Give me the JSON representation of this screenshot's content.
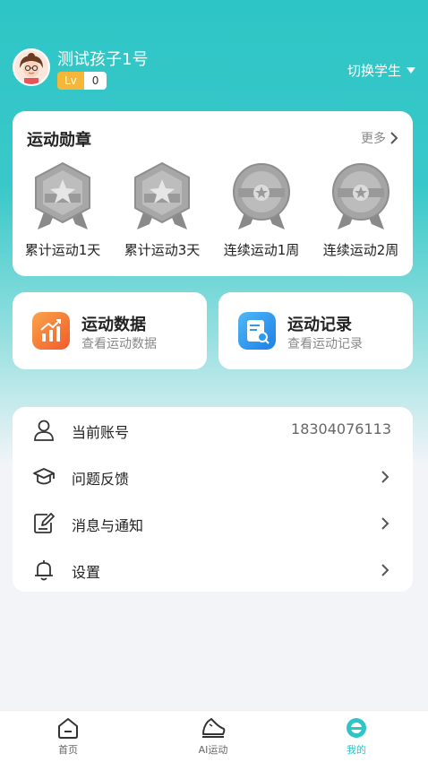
{
  "header": {
    "username": "测试孩子1号",
    "level_tag": "Lv",
    "level_value": "0",
    "switch_label": "切换学生"
  },
  "medals": {
    "title": "运动勋章",
    "more_label": "更多",
    "items": [
      {
        "label": "累计运动1天",
        "icon": "hexagon-star-medal-icon"
      },
      {
        "label": "累计运动3天",
        "icon": "hexagon-star-medal-icon"
      },
      {
        "label": "连续运动1周",
        "icon": "round-star-medal-icon"
      },
      {
        "label": "连续运动2周",
        "icon": "round-star-medal-icon"
      }
    ]
  },
  "tiles": {
    "data": {
      "title": "运动数据",
      "subtitle": "查看运动数据",
      "color": "#f47a3a"
    },
    "record": {
      "title": "运动记录",
      "subtitle": "查看运动记录",
      "color": "#2d9af0"
    }
  },
  "menu": {
    "items": [
      {
        "label": "当前账号",
        "value": "18304076113",
        "icon": "user-icon"
      },
      {
        "label": "问题反馈",
        "icon": "graduation-cap-icon"
      },
      {
        "label": "消息与通知",
        "icon": "edit-note-icon"
      },
      {
        "label": "设置",
        "icon": "bell-icon"
      }
    ]
  },
  "tabbar": {
    "items": [
      {
        "label": "首页",
        "icon": "home-icon"
      },
      {
        "label": "AI运动",
        "icon": "shoe-icon"
      },
      {
        "label": "我的",
        "icon": "profile-icon",
        "active": true
      }
    ]
  },
  "colors": {
    "accent": "#2ec5c6",
    "medal_gray": "#9a9a9a"
  }
}
